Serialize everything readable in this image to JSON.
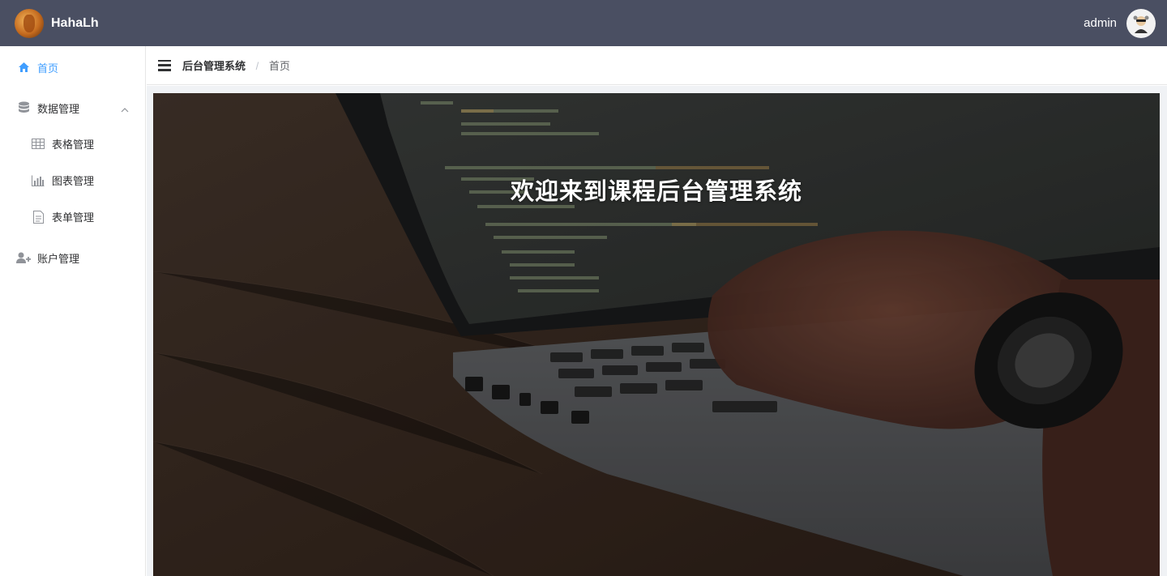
{
  "header": {
    "brand": "HahaLh",
    "user_name": "admin"
  },
  "sidebar": {
    "items": [
      {
        "label": "首页",
        "icon": "home-icon",
        "active": true
      },
      {
        "label": "数据管理",
        "icon": "database-icon",
        "expanded": true,
        "children": [
          {
            "label": "表格管理",
            "icon": "table-icon"
          },
          {
            "label": "图表管理",
            "icon": "bar-chart-icon"
          },
          {
            "label": "表单管理",
            "icon": "document-icon"
          }
        ]
      },
      {
        "label": "账户管理",
        "icon": "user-add-icon"
      }
    ]
  },
  "breadcrumb": {
    "root": "后台管理系统",
    "separator": "/",
    "current": "首页"
  },
  "hero": {
    "title": "欢迎来到课程后台管理系统"
  },
  "colors": {
    "header_bg": "#4a4f62",
    "accent": "#409eff"
  }
}
